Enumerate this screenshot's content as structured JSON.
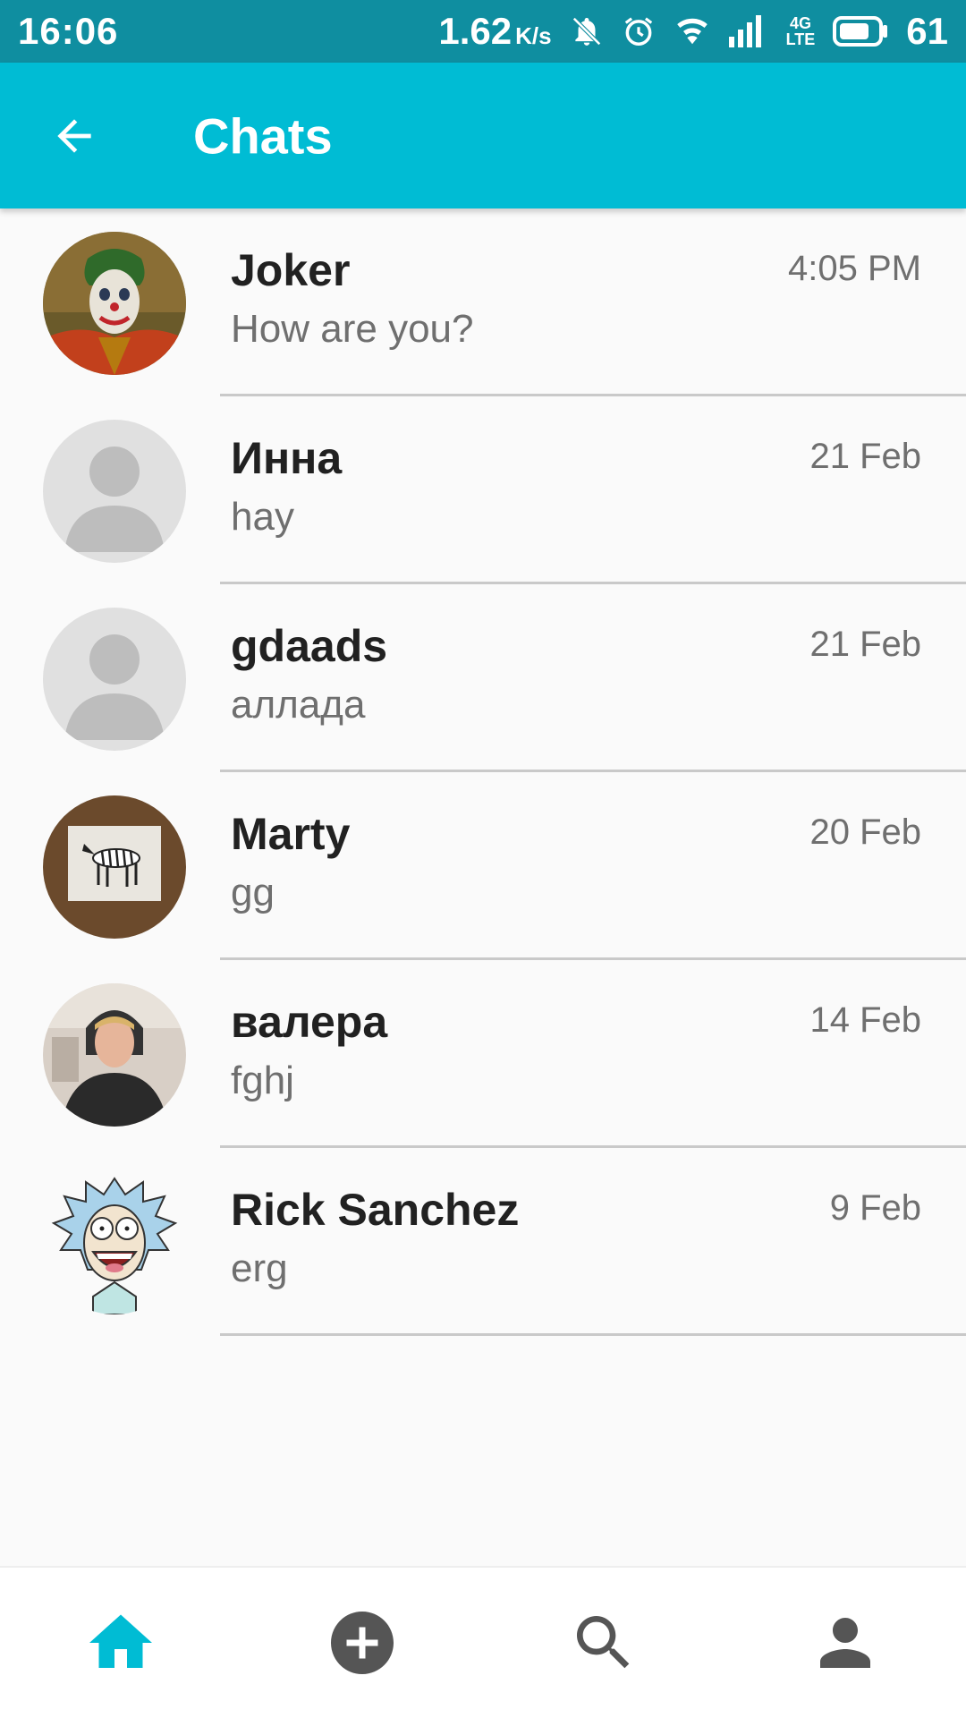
{
  "status_bar": {
    "time": "16:06",
    "speed": "1.62",
    "speed_unit": "K/s",
    "network": "4G",
    "network_sub": "LTE",
    "battery": "61"
  },
  "header": {
    "title": "Chats",
    "back_icon": "arrow-back-icon"
  },
  "colors": {
    "status_bar": "#0f8ea0",
    "app_bar": "#00bcd4",
    "accent": "#00bcd4",
    "nav_inactive": "#555555"
  },
  "chats": [
    {
      "name": "Joker",
      "preview": "How are you?",
      "time": "4:05 PM",
      "avatar": "joker-photo"
    },
    {
      "name": "Инна",
      "preview": "hay",
      "time": "21 Feb",
      "avatar": "default-person-avatar"
    },
    {
      "name": "gdaads",
      "preview": "аллада",
      "time": "21 Feb",
      "avatar": "default-person-avatar"
    },
    {
      "name": "Marty",
      "preview": "gg",
      "time": "20 Feb",
      "avatar": "zebra-photo"
    },
    {
      "name": "валера",
      "preview": "fghj",
      "time": "14 Feb",
      "avatar": "person-photo"
    },
    {
      "name": "Rick Sanchez",
      "preview": "erg",
      "time": "9 Feb",
      "avatar": "rick-cartoon"
    }
  ],
  "bottom_nav": {
    "items": [
      {
        "icon": "home-icon",
        "active": true
      },
      {
        "icon": "add-circle-icon",
        "active": false
      },
      {
        "icon": "search-icon",
        "active": false
      },
      {
        "icon": "person-icon",
        "active": false
      }
    ]
  }
}
